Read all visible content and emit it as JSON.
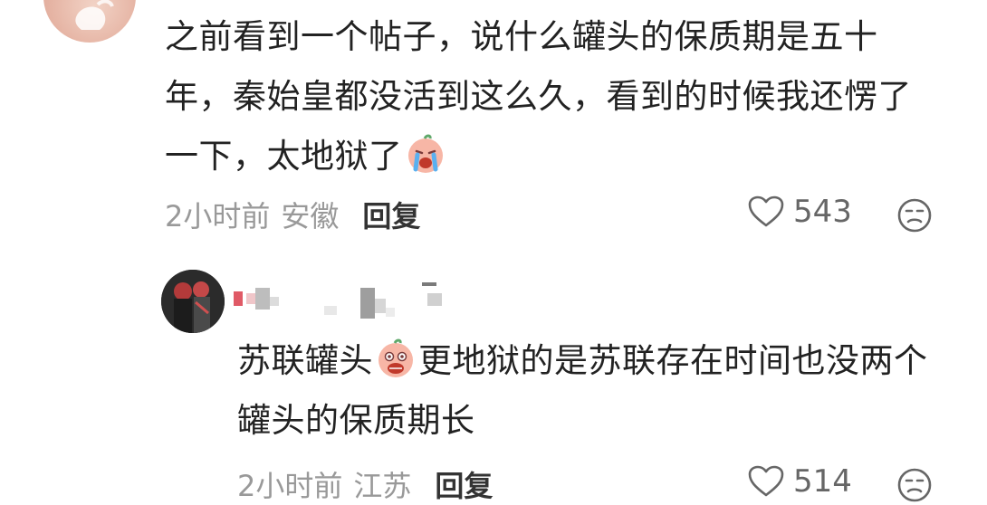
{
  "comments": [
    {
      "text_before_emoji": "之前看到一个帖子，说什么罐头的保质期是五十年，秦始皇都没活到这么久，看到的时候我还愣了一下，太地狱了",
      "text_after_emoji": "",
      "emoji_icon": "crying-face-emoji",
      "time": "2小时前",
      "location": "安徽",
      "reply_label": "回复",
      "likes": "543"
    },
    {
      "text_before_emoji": "苏联罐头",
      "text_after_emoji": "更地狱的是苏联存在时间也没两个罐头的保质期长",
      "emoji_icon": "shocked-face-emoji",
      "time": "2小时前",
      "location": "江苏",
      "reply_label": "回复",
      "likes": "514"
    }
  ],
  "colors": {
    "text": "#222222",
    "meta": "#999999",
    "icon": "#666666"
  }
}
